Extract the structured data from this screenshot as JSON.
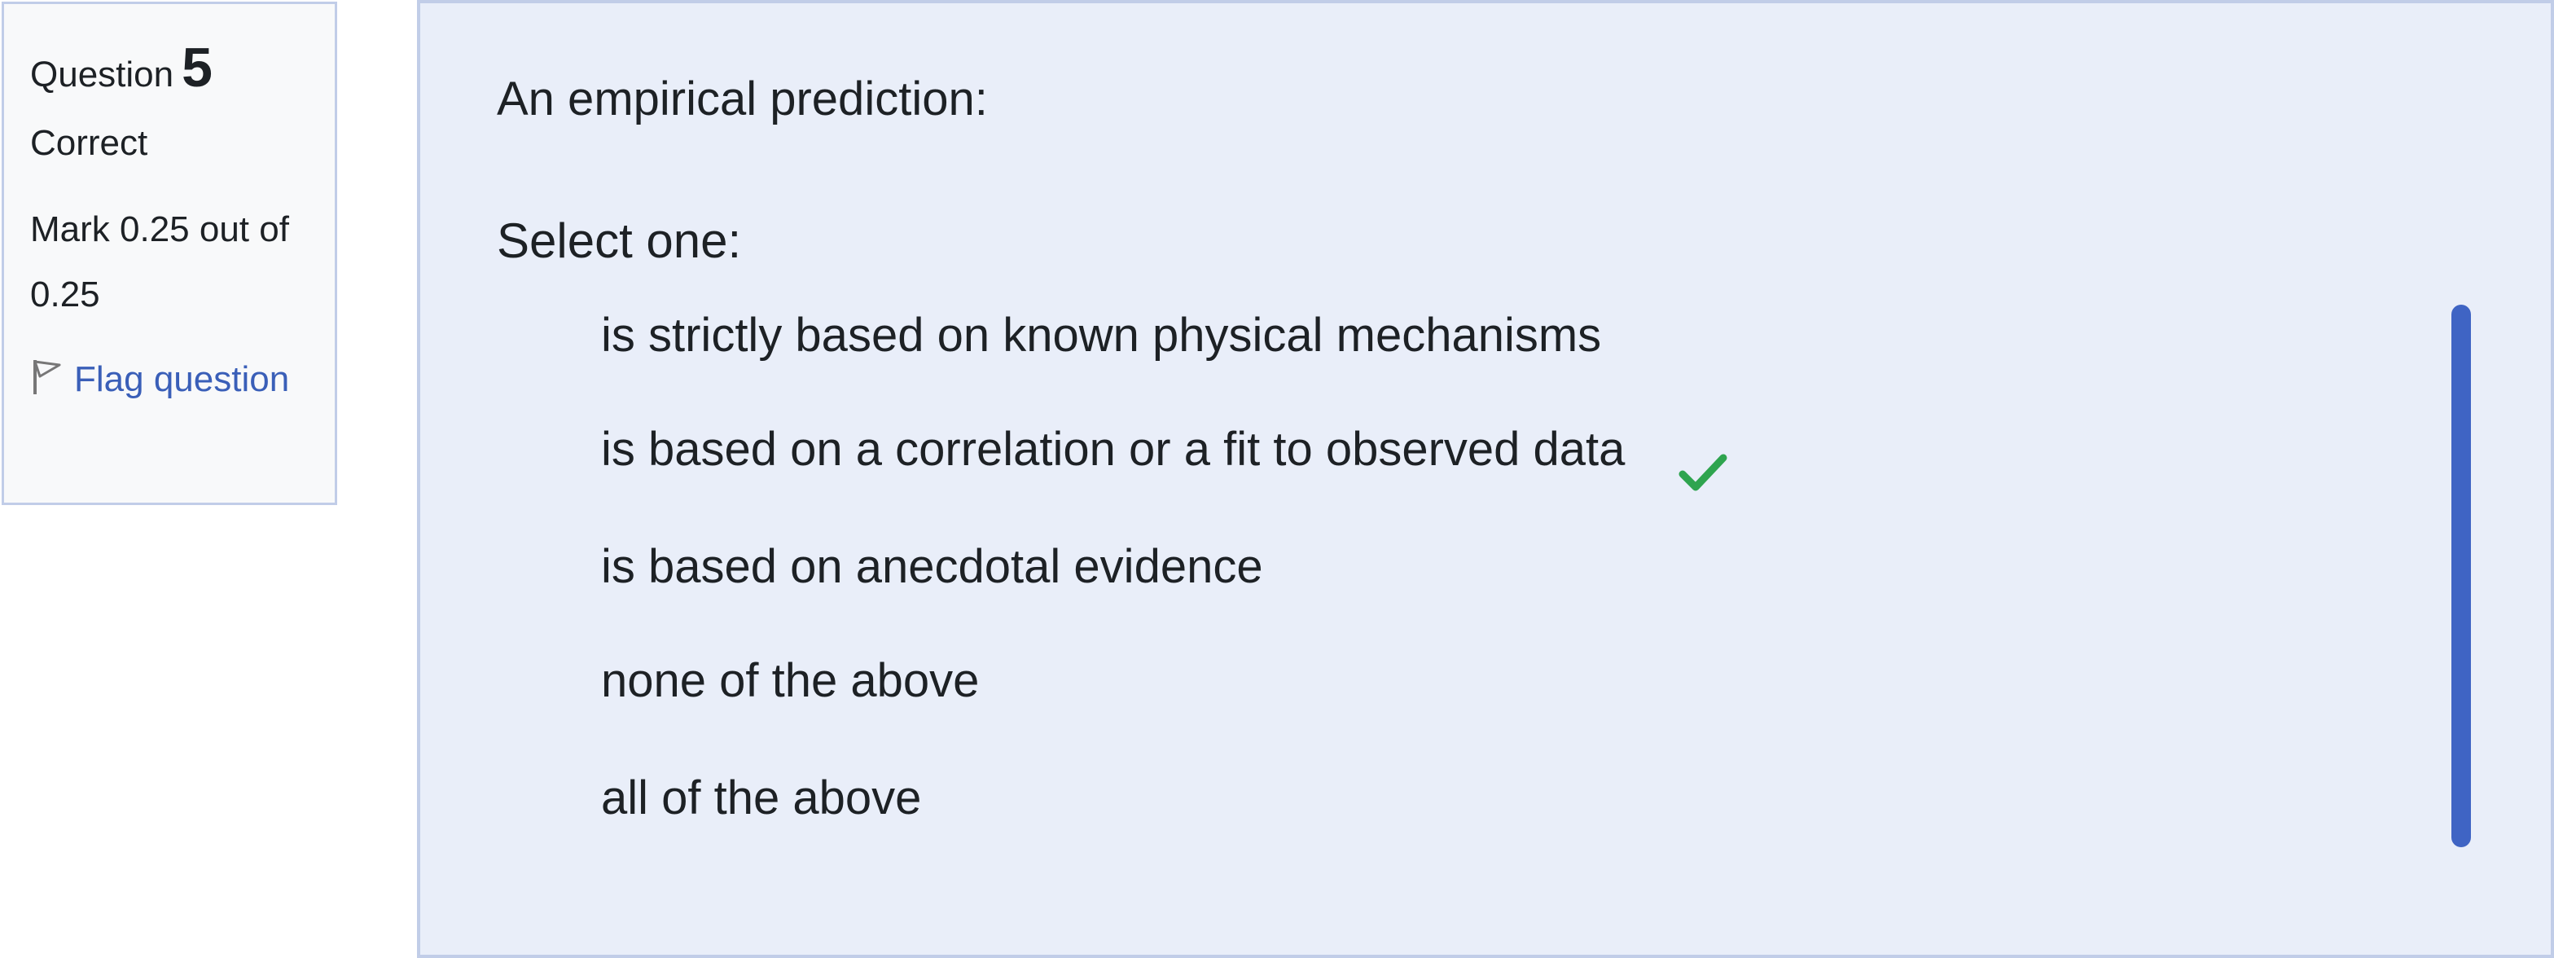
{
  "info": {
    "question_label": "Question",
    "question_number": "5",
    "state": "Correct",
    "grade": "Mark 0.25 out of 0.25",
    "flag_label": "Flag question"
  },
  "question": {
    "text": "An empirical prediction:",
    "prompt": "Select one:",
    "options": [
      "is strictly based on known physical mechanisms",
      "is based on a correlation or a fit to observed data",
      "is based on anecdotal evidence",
      "none of the above",
      "all of the above"
    ]
  },
  "icons": {
    "flag": "flag-icon",
    "check": "checkmark-icon"
  },
  "colors": {
    "accent": "#3f64c4",
    "link": "#3a5fb8",
    "correct": "#2ea44f",
    "panel_bg": "#e9eef9",
    "info_bg": "#f8f9fa",
    "border": "#c1cde8"
  }
}
